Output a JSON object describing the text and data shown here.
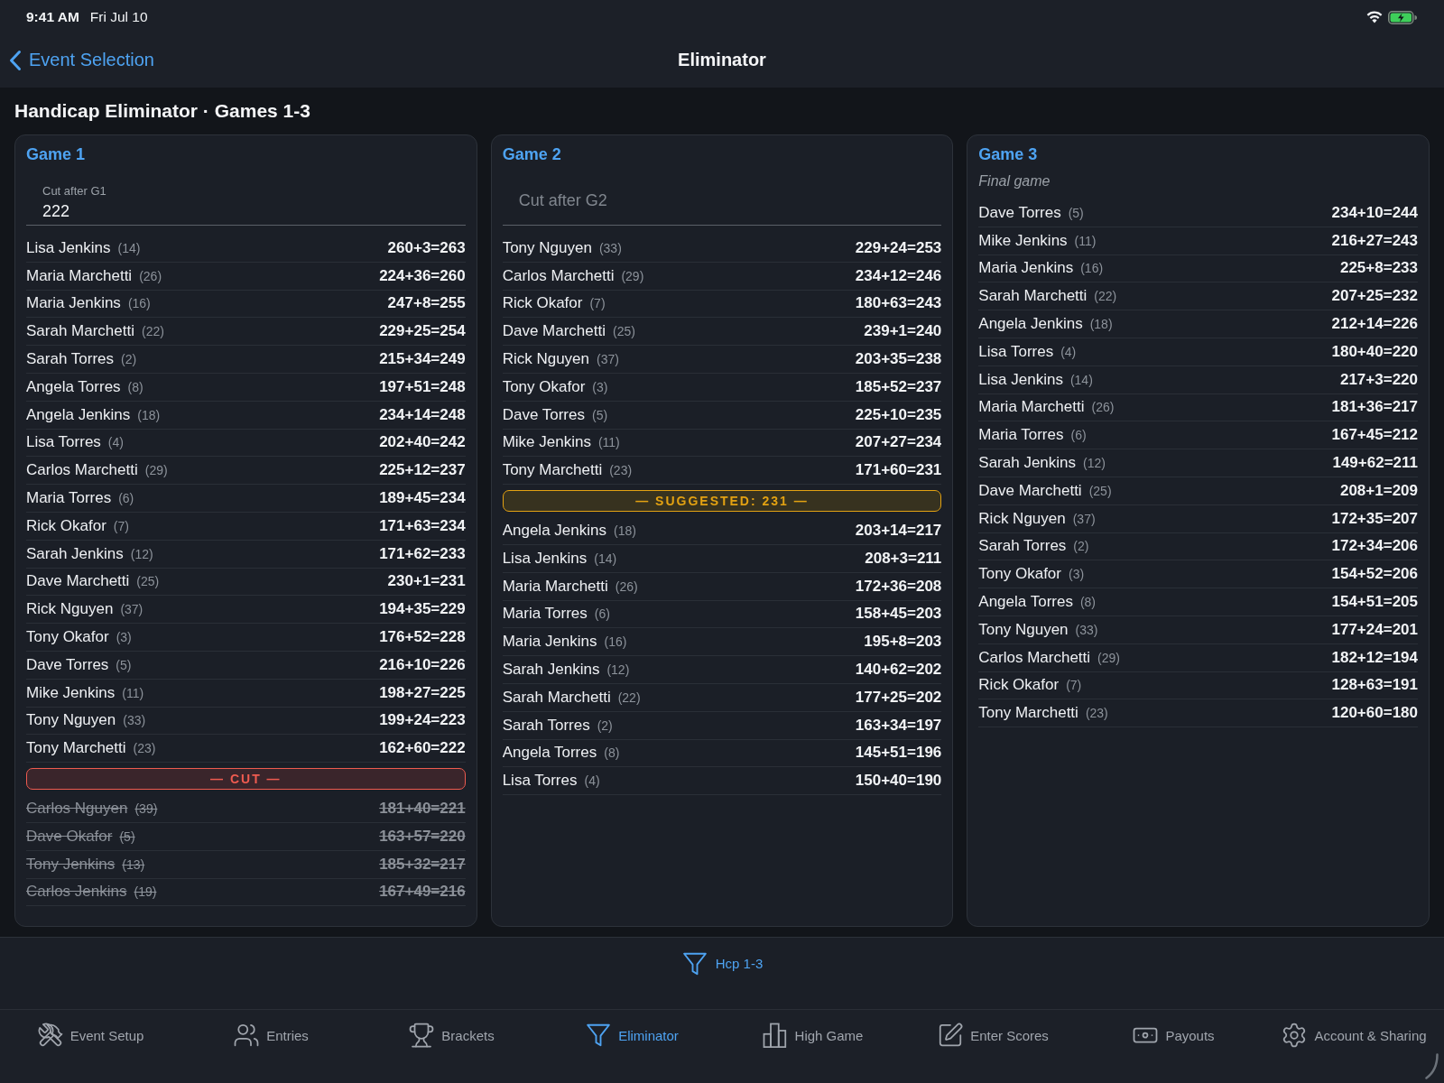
{
  "status_bar": {
    "time": "9:41 AM",
    "date": "Fri Jul 10"
  },
  "nav": {
    "back_label": "Event Selection",
    "title": "Eliminator"
  },
  "heading": "Handicap Eliminator · Games 1-3",
  "games": [
    {
      "title": "Game 1",
      "cut_field": {
        "label": "Cut after G1",
        "value": "222"
      },
      "rows": [
        {
          "kind": "entry",
          "name": "Lisa Jenkins",
          "hcp": "(14)",
          "score": "260+3=263",
          "eliminated": false
        },
        {
          "kind": "entry",
          "name": "Maria Marchetti",
          "hcp": "(26)",
          "score": "224+36=260",
          "eliminated": false
        },
        {
          "kind": "entry",
          "name": "Maria Jenkins",
          "hcp": "(16)",
          "score": "247+8=255",
          "eliminated": false
        },
        {
          "kind": "entry",
          "name": "Sarah Marchetti",
          "hcp": "(22)",
          "score": "229+25=254",
          "eliminated": false
        },
        {
          "kind": "entry",
          "name": "Sarah Torres",
          "hcp": "(2)",
          "score": "215+34=249",
          "eliminated": false
        },
        {
          "kind": "entry",
          "name": "Angela Torres",
          "hcp": "(8)",
          "score": "197+51=248",
          "eliminated": false
        },
        {
          "kind": "entry",
          "name": "Angela Jenkins",
          "hcp": "(18)",
          "score": "234+14=248",
          "eliminated": false
        },
        {
          "kind": "entry",
          "name": "Lisa Torres",
          "hcp": "(4)",
          "score": "202+40=242",
          "eliminated": false
        },
        {
          "kind": "entry",
          "name": "Carlos Marchetti",
          "hcp": "(29)",
          "score": "225+12=237",
          "eliminated": false
        },
        {
          "kind": "entry",
          "name": "Maria Torres",
          "hcp": "(6)",
          "score": "189+45=234",
          "eliminated": false
        },
        {
          "kind": "entry",
          "name": "Rick Okafor",
          "hcp": "(7)",
          "score": "171+63=234",
          "eliminated": false
        },
        {
          "kind": "entry",
          "name": "Sarah Jenkins",
          "hcp": "(12)",
          "score": "171+62=233",
          "eliminated": false
        },
        {
          "kind": "entry",
          "name": "Dave Marchetti",
          "hcp": "(25)",
          "score": "230+1=231",
          "eliminated": false
        },
        {
          "kind": "entry",
          "name": "Rick Nguyen",
          "hcp": "(37)",
          "score": "194+35=229",
          "eliminated": false
        },
        {
          "kind": "entry",
          "name": "Tony Okafor",
          "hcp": "(3)",
          "score": "176+52=228",
          "eliminated": false
        },
        {
          "kind": "entry",
          "name": "Dave Torres",
          "hcp": "(5)",
          "score": "216+10=226",
          "eliminated": false
        },
        {
          "kind": "entry",
          "name": "Mike Jenkins",
          "hcp": "(11)",
          "score": "198+27=225",
          "eliminated": false
        },
        {
          "kind": "entry",
          "name": "Tony Nguyen",
          "hcp": "(33)",
          "score": "199+24=223",
          "eliminated": false
        },
        {
          "kind": "entry",
          "name": "Tony Marchetti",
          "hcp": "(23)",
          "score": "162+60=222",
          "eliminated": false
        },
        {
          "kind": "cut",
          "label": "— CUT —"
        },
        {
          "kind": "entry",
          "name": "Carlos Nguyen",
          "hcp": "(39)",
          "score": "181+40=221",
          "eliminated": true
        },
        {
          "kind": "entry",
          "name": "Dave Okafor",
          "hcp": "(5)",
          "score": "163+57=220",
          "eliminated": true
        },
        {
          "kind": "entry",
          "name": "Tony Jenkins",
          "hcp": "(13)",
          "score": "185+32=217",
          "eliminated": true
        },
        {
          "kind": "entry",
          "name": "Carlos Jenkins",
          "hcp": "(19)",
          "score": "167+49=216",
          "eliminated": true
        }
      ]
    },
    {
      "title": "Game 2",
      "cut_field": {
        "placeholder": "Cut after G2"
      },
      "rows": [
        {
          "kind": "entry",
          "name": "Tony Nguyen",
          "hcp": "(33)",
          "score": "229+24=253",
          "eliminated": false
        },
        {
          "kind": "entry",
          "name": "Carlos Marchetti",
          "hcp": "(29)",
          "score": "234+12=246",
          "eliminated": false
        },
        {
          "kind": "entry",
          "name": "Rick Okafor",
          "hcp": "(7)",
          "score": "180+63=243",
          "eliminated": false
        },
        {
          "kind": "entry",
          "name": "Dave Marchetti",
          "hcp": "(25)",
          "score": "239+1=240",
          "eliminated": false
        },
        {
          "kind": "entry",
          "name": "Rick Nguyen",
          "hcp": "(37)",
          "score": "203+35=238",
          "eliminated": false
        },
        {
          "kind": "entry",
          "name": "Tony Okafor",
          "hcp": "(3)",
          "score": "185+52=237",
          "eliminated": false
        },
        {
          "kind": "entry",
          "name": "Dave Torres",
          "hcp": "(5)",
          "score": "225+10=235",
          "eliminated": false
        },
        {
          "kind": "entry",
          "name": "Mike Jenkins",
          "hcp": "(11)",
          "score": "207+27=234",
          "eliminated": false
        },
        {
          "kind": "entry",
          "name": "Tony Marchetti",
          "hcp": "(23)",
          "score": "171+60=231",
          "eliminated": false
        },
        {
          "kind": "suggested",
          "label": "— SUGGESTED: 231 —"
        },
        {
          "kind": "entry",
          "name": "Angela Jenkins",
          "hcp": "(18)",
          "score": "203+14=217",
          "eliminated": false
        },
        {
          "kind": "entry",
          "name": "Lisa Jenkins",
          "hcp": "(14)",
          "score": "208+3=211",
          "eliminated": false
        },
        {
          "kind": "entry",
          "name": "Maria Marchetti",
          "hcp": "(26)",
          "score": "172+36=208",
          "eliminated": false
        },
        {
          "kind": "entry",
          "name": "Maria Torres",
          "hcp": "(6)",
          "score": "158+45=203",
          "eliminated": false
        },
        {
          "kind": "entry",
          "name": "Maria Jenkins",
          "hcp": "(16)",
          "score": "195+8=203",
          "eliminated": false
        },
        {
          "kind": "entry",
          "name": "Sarah Jenkins",
          "hcp": "(12)",
          "score": "140+62=202",
          "eliminated": false
        },
        {
          "kind": "entry",
          "name": "Sarah Marchetti",
          "hcp": "(22)",
          "score": "177+25=202",
          "eliminated": false
        },
        {
          "kind": "entry",
          "name": "Sarah Torres",
          "hcp": "(2)",
          "score": "163+34=197",
          "eliminated": false
        },
        {
          "kind": "entry",
          "name": "Angela Torres",
          "hcp": "(8)",
          "score": "145+51=196",
          "eliminated": false
        },
        {
          "kind": "entry",
          "name": "Lisa Torres",
          "hcp": "(4)",
          "score": "150+40=190",
          "eliminated": false
        }
      ]
    },
    {
      "title": "Game 3",
      "subtitle": "Final game",
      "rows": [
        {
          "kind": "entry",
          "name": "Dave Torres",
          "hcp": "(5)",
          "score": "234+10=244",
          "eliminated": false
        },
        {
          "kind": "entry",
          "name": "Mike Jenkins",
          "hcp": "(11)",
          "score": "216+27=243",
          "eliminated": false
        },
        {
          "kind": "entry",
          "name": "Maria Jenkins",
          "hcp": "(16)",
          "score": "225+8=233",
          "eliminated": false
        },
        {
          "kind": "entry",
          "name": "Sarah Marchetti",
          "hcp": "(22)",
          "score": "207+25=232",
          "eliminated": false
        },
        {
          "kind": "entry",
          "name": "Angela Jenkins",
          "hcp": "(18)",
          "score": "212+14=226",
          "eliminated": false
        },
        {
          "kind": "entry",
          "name": "Lisa Torres",
          "hcp": "(4)",
          "score": "180+40=220",
          "eliminated": false
        },
        {
          "kind": "entry",
          "name": "Lisa Jenkins",
          "hcp": "(14)",
          "score": "217+3=220",
          "eliminated": false
        },
        {
          "kind": "entry",
          "name": "Maria Marchetti",
          "hcp": "(26)",
          "score": "181+36=217",
          "eliminated": false
        },
        {
          "kind": "entry",
          "name": "Maria Torres",
          "hcp": "(6)",
          "score": "167+45=212",
          "eliminated": false
        },
        {
          "kind": "entry",
          "name": "Sarah Jenkins",
          "hcp": "(12)",
          "score": "149+62=211",
          "eliminated": false
        },
        {
          "kind": "entry",
          "name": "Dave Marchetti",
          "hcp": "(25)",
          "score": "208+1=209",
          "eliminated": false
        },
        {
          "kind": "entry",
          "name": "Rick Nguyen",
          "hcp": "(37)",
          "score": "172+35=207",
          "eliminated": false
        },
        {
          "kind": "entry",
          "name": "Sarah Torres",
          "hcp": "(2)",
          "score": "172+34=206",
          "eliminated": false
        },
        {
          "kind": "entry",
          "name": "Tony Okafor",
          "hcp": "(3)",
          "score": "154+52=206",
          "eliminated": false
        },
        {
          "kind": "entry",
          "name": "Angela Torres",
          "hcp": "(8)",
          "score": "154+51=205",
          "eliminated": false
        },
        {
          "kind": "entry",
          "name": "Tony Nguyen",
          "hcp": "(33)",
          "score": "177+24=201",
          "eliminated": false
        },
        {
          "kind": "entry",
          "name": "Carlos Marchetti",
          "hcp": "(29)",
          "score": "182+12=194",
          "eliminated": false
        },
        {
          "kind": "entry",
          "name": "Rick Okafor",
          "hcp": "(7)",
          "score": "128+63=191",
          "eliminated": false
        },
        {
          "kind": "entry",
          "name": "Tony Marchetti",
          "hcp": "(23)",
          "score": "120+60=180",
          "eliminated": false
        }
      ]
    }
  ],
  "filter_chip": {
    "label": "Hcp 1-3"
  },
  "tabs": [
    {
      "label": "Event Setup",
      "selected": false
    },
    {
      "label": "Entries",
      "selected": false
    },
    {
      "label": "Brackets",
      "selected": false
    },
    {
      "label": "Eliminator",
      "selected": true
    },
    {
      "label": "High Game",
      "selected": false
    },
    {
      "label": "Enter Scores",
      "selected": false
    },
    {
      "label": "Payouts",
      "selected": false
    },
    {
      "label": "Account & Sharing",
      "selected": false
    }
  ]
}
